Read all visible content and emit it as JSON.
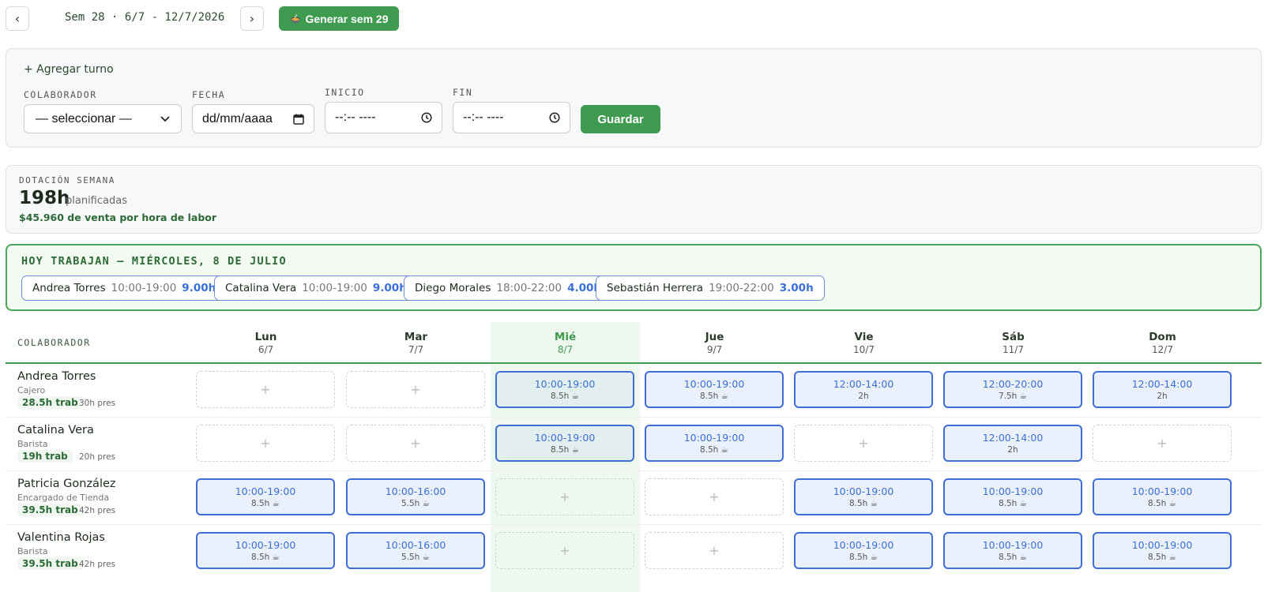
{
  "topbar": {
    "prev_icon": "‹",
    "next_icon": "›",
    "week_label": "Sem 28 · 6/7 - 12/7/2026",
    "generate_icon": "🍲",
    "generate_label": "Generar sem 29"
  },
  "add_shift": {
    "title": "+ Agregar turno",
    "collaborator_label": "COLABORADOR",
    "collaborator_value": "— seleccionar —",
    "date_label": "FECHA",
    "date_placeholder": "dd/mm/aaaa",
    "start_label": "INICIO",
    "start_placeholder": "--:-- ----",
    "end_label": "FIN",
    "end_placeholder": "--:-- ----",
    "save_label": "Guardar"
  },
  "staffing": {
    "label": "DOTACIÓN SEMANA",
    "hours": "198h",
    "hours_sub": "planificadas",
    "sales": "$45.960 de venta por hora de labor"
  },
  "today": {
    "title": "HOY TRABAJAN — MIÉRCOLES, 8 DE JULIO",
    "chips": [
      {
        "name": "Andrea Torres",
        "time": "10:00-19:00",
        "hours": "9.00h"
      },
      {
        "name": "Catalina Vera",
        "time": "10:00-19:00",
        "hours": "9.00h"
      },
      {
        "name": "Diego Morales",
        "time": "18:00-22:00",
        "hours": "4.00h"
      },
      {
        "name": "Sebastián Herrera",
        "time": "19:00-22:00",
        "hours": "3.00h"
      }
    ]
  },
  "grid": {
    "header_label": "COLABORADOR",
    "days": [
      {
        "name": "Lun",
        "date": "6/7"
      },
      {
        "name": "Mar",
        "date": "7/7"
      },
      {
        "name": "Mié",
        "date": "8/7"
      },
      {
        "name": "Jue",
        "date": "9/7"
      },
      {
        "name": "Vie",
        "date": "10/7"
      },
      {
        "name": "Sáb",
        "date": "11/7"
      },
      {
        "name": "Dom",
        "date": "12/7"
      }
    ],
    "add_icon": "+",
    "rows": [
      {
        "name": "Andrea Torres",
        "role": "Cajero",
        "worked": "28.5h trab",
        "budget": "30h pres",
        "shifts": [
          null,
          null,
          {
            "time": "10:00-19:00",
            "hours": "8.5h ☕"
          },
          {
            "time": "10:00-19:00",
            "hours": "8.5h ☕"
          },
          {
            "time": "12:00-14:00",
            "hours": "2h"
          },
          {
            "time": "12:00-20:00",
            "hours": "7.5h ☕"
          },
          {
            "time": "12:00-14:00",
            "hours": "2h"
          }
        ]
      },
      {
        "name": "Catalina Vera",
        "role": "Barista",
        "worked": "19h trab",
        "budget": "20h pres",
        "shifts": [
          null,
          null,
          {
            "time": "10:00-19:00",
            "hours": "8.5h ☕"
          },
          {
            "time": "10:00-19:00",
            "hours": "8.5h ☕"
          },
          null,
          {
            "time": "12:00-14:00",
            "hours": "2h"
          },
          null
        ]
      },
      {
        "name": "Patricia González",
        "role": "Encargado de Tienda",
        "worked": "39.5h trab",
        "budget": "42h pres",
        "shifts": [
          {
            "time": "10:00-19:00",
            "hours": "8.5h ☕"
          },
          {
            "time": "10:00-16:00",
            "hours": "5.5h ☕"
          },
          null,
          null,
          {
            "time": "10:00-19:00",
            "hours": "8.5h ☕"
          },
          {
            "time": "10:00-19:00",
            "hours": "8.5h ☕"
          },
          {
            "time": "10:00-19:00",
            "hours": "8.5h ☕"
          }
        ]
      },
      {
        "name": "Valentina Rojas",
        "role": "Barista",
        "worked": "39.5h trab",
        "budget": "42h pres",
        "shifts": [
          {
            "time": "10:00-19:00",
            "hours": "8.5h ☕"
          },
          {
            "time": "10:00-16:00",
            "hours": "5.5h ☕"
          },
          null,
          null,
          {
            "time": "10:00-19:00",
            "hours": "8.5h ☕"
          },
          {
            "time": "10:00-19:00",
            "hours": "8.5h ☕"
          },
          {
            "time": "10:00-19:00",
            "hours": "8.5h ☕"
          }
        ]
      }
    ]
  },
  "colors": {
    "accent_green": "#3f9b4f",
    "shift_blue": "#3f6fd6",
    "today_bg": "#eef8ee"
  }
}
